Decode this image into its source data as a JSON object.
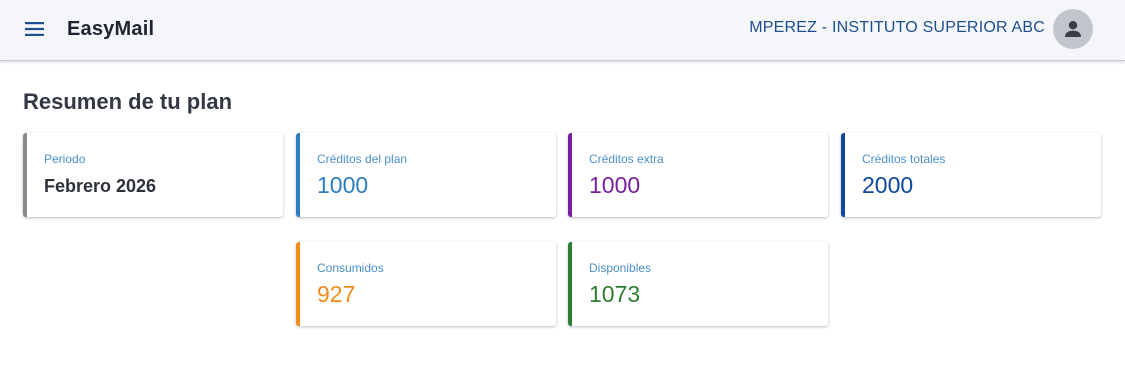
{
  "header": {
    "app_title": "EasyMail",
    "account_name": "MPEREZ - INSTITUTO SUPERIOR ABC",
    "menu_icon": "menu-icon",
    "avatar_icon": "account-icon"
  },
  "summary": {
    "title": "Resumen de tu plan",
    "cards": [
      {
        "label": "Periodo",
        "value": "Febrero 2026",
        "color": "#8a8a8a"
      },
      {
        "label": "Créditos del plan",
        "value": "1000",
        "color": "#2b7fc4"
      },
      {
        "label": "Créditos extra",
        "value": "1000",
        "color": "#7b1fa2"
      },
      {
        "label": "Créditos totales",
        "value": "2000",
        "color": "#0d47a1"
      },
      {
        "label": "Consumidos",
        "value": "927",
        "color": "#ef8c1b"
      },
      {
        "label": "Disponibles",
        "value": "1073",
        "color": "#2e7d32"
      }
    ]
  }
}
